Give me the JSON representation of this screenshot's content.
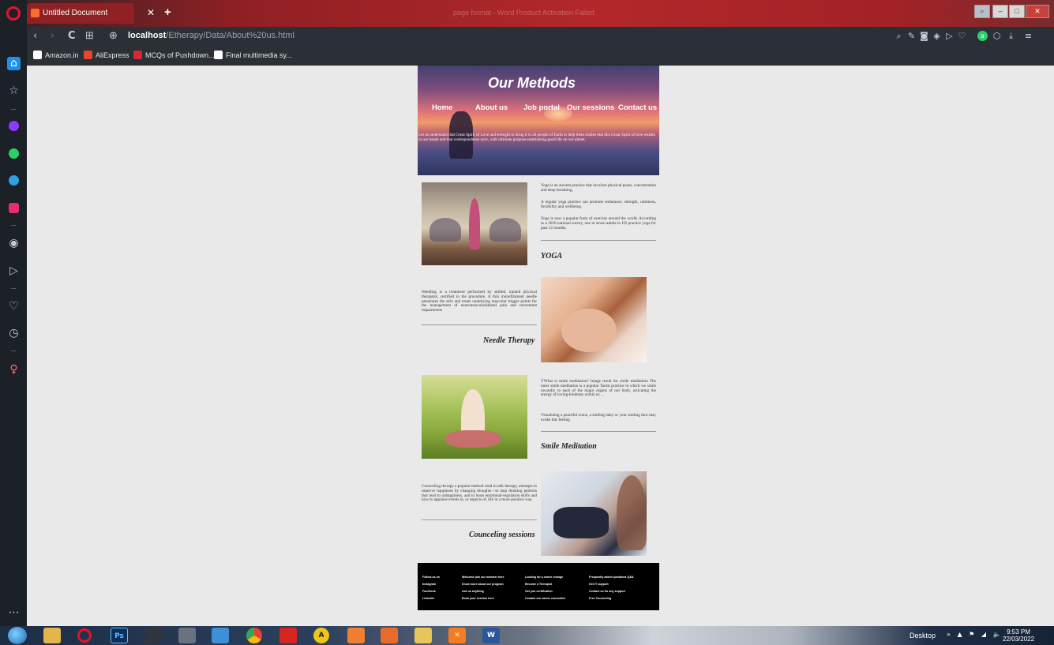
{
  "browser": {
    "tab_title": "Untitled Document",
    "tab_close": "✕",
    "new_tab": "+",
    "window_title": "page format - Word Product Activation Failed",
    "url_host": "localhost",
    "url_path": "/Etherapy/Data/About%20us.html",
    "nav": {
      "back": "‹",
      "forward": "›",
      "reload": "C",
      "speed_dial": "⊞",
      "site_info": "⊕"
    },
    "bookmarks": [
      "Amazon.in",
      "AliExpress",
      "MCQs of Pushdown...",
      "Final multimedia sy..."
    ],
    "bookmark_colors": [
      "#ffffff",
      "#e8452c",
      "#d22a3a",
      "#ffffff"
    ]
  },
  "sidebar": {
    "icons": [
      "home-icon",
      "star-icon",
      "messenger-icon",
      "whatsapp-icon",
      "telegram-icon",
      "instagram-icon",
      "player-icon",
      "flow-icon",
      "heart-icon",
      "history-icon",
      "pin-icon",
      "more-icon"
    ]
  },
  "page": {
    "hero": {
      "title": "Our Methods",
      "nav": [
        "Home",
        "About us",
        "Job portal",
        "Our sessions",
        "Contact us"
      ],
      "text": "Let us understand that Great Spirit of Love and strength to bring it to all people of Earth to help them realise that this Great Spirit of love resides in our hands and that correspondence sync, with ultimate purpose establishing good life on our planet."
    },
    "yoga": {
      "paragraphs": [
        "Yoga is an ancient practice that involves physical poses, concentration and deep breathing.",
        "A regular yoga practice can promote endurance, strength, calmness, flexibility and wellbeing.",
        "Yoga is now a popular form of exercise around the world. According to a 2018 national survey, one in seven adults in US practice yoga for past 12 months."
      ],
      "title": "YOGA"
    },
    "needle": {
      "paragraph": "Needling is a treatment performed by skilled, trained physical therapists, certified in the procedure. A thin monofilament needle penetrates the skin and treats underlying muscular trigger points for the management of neuromusculoskeletal pain and movement impairments",
      "title": "Needle Therapy"
    },
    "smile": {
      "paragraphs": [
        "YWhat is smile meditation? Image result for smile meditation The inner smile meditation is a popular Taoist practice in which we smile inwardly to each of the major organs of our body, activating the energy of loving-kindness within us ...",
        "Visualizing a peaceful scene, a smiling baby or your smiling face may evoke this feeling"
      ],
      "title": "Smile Meditation"
    },
    "counseling": {
      "paragraph": "Counceling therapy a popular method used in talk therapy, attempts to improve happiness by changing thoughts—to stop thinking patterns that lead to unhappiness, and to learn emotional-regulation skills and how to appraise events in, or aspects of, life in a more positive way.",
      "title": "Counceling sessions"
    },
    "footer": {
      "columns": [
        [
          "Follow us on",
          "Instagram",
          "Facebook",
          "LinkedIn"
        ],
        [
          "Welcome join our member here",
          "Know more about our program",
          "Ask us anything",
          "Book your session here"
        ],
        [
          "Looking for a career change",
          "Become a Therapist",
          "Get you certification",
          "Contact our career counsellor"
        ],
        [
          "Frequently asked questions Q&A",
          "Get IT support",
          "Contact us for any support",
          "Free Counseling"
        ]
      ]
    }
  },
  "taskbar": {
    "apps": [
      "explorer",
      "opera",
      "photoshop",
      "network",
      "tool",
      "notes",
      "chrome",
      "acrobat",
      "authy",
      "app-orange",
      "app-store",
      "folder",
      "xampp",
      "word"
    ],
    "desktop_label": "Desktop",
    "tray": "»  ▲ ⚑ ◢ 🔈",
    "time": "9:53 PM",
    "date": "22/03/2022"
  }
}
